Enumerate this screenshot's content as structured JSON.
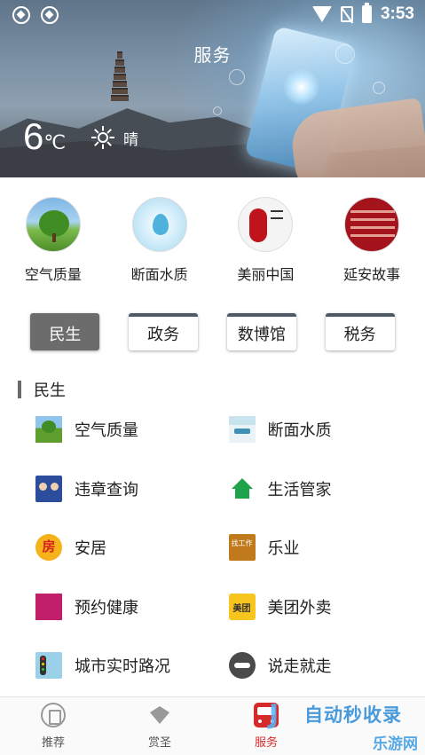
{
  "status_bar": {
    "time": "3:53"
  },
  "header": {
    "title": "服务",
    "temperature": "6",
    "temp_unit": "℃",
    "weather": "晴"
  },
  "shortcuts": [
    {
      "label": "空气质量",
      "icon": "tree-icon"
    },
    {
      "label": "断面水质",
      "icon": "water-drop-icon"
    },
    {
      "label": "美丽中国",
      "icon": "china-seal-icon"
    },
    {
      "label": "延安故事",
      "icon": "story-badge-icon"
    }
  ],
  "tabs": [
    {
      "label": "民生",
      "active": true
    },
    {
      "label": "政务",
      "active": false
    },
    {
      "label": "数博馆",
      "active": false
    },
    {
      "label": "税务",
      "active": false
    }
  ],
  "section": {
    "title": "民生",
    "items": [
      {
        "label": "空气质量",
        "icon": "tree-icon"
      },
      {
        "label": "断面水质",
        "icon": "water-icon"
      },
      {
        "label": "违章查询",
        "icon": "police-icon"
      },
      {
        "label": "生活管家",
        "icon": "home-icon"
      },
      {
        "label": "安居",
        "icon": "house-icon"
      },
      {
        "label": "乐业",
        "icon": "job-icon"
      },
      {
        "label": "预约健康",
        "icon": "health-icon"
      },
      {
        "label": "美团外卖",
        "icon": "meituan-icon"
      },
      {
        "label": "城市实时路况",
        "icon": "traffic-light-icon"
      },
      {
        "label": "说走就走",
        "icon": "train-icon"
      }
    ]
  },
  "bottom_nav": [
    {
      "label": "推荐",
      "icon": "recommend-icon",
      "active": false
    },
    {
      "label": "赏圣",
      "icon": "diamond-icon",
      "active": false
    },
    {
      "label": "服务",
      "icon": "bus-icon",
      "active": true
    }
  ],
  "watermark": {
    "line1": "自动秒收录",
    "line2": "乐游网"
  },
  "colors": {
    "active_nav": "#d62a2a",
    "active_tab_bg": "#6c6c6c",
    "tab_top_border": "#4d5966"
  }
}
